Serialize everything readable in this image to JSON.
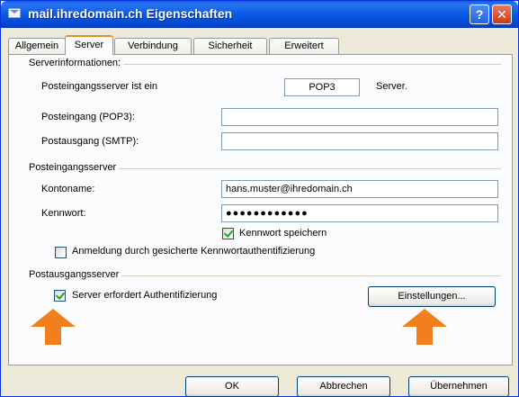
{
  "window": {
    "title": "mail.ihredomain.ch Eigenschaften",
    "help_label": "?",
    "close_label": "✕"
  },
  "tabs": [
    {
      "label": "Allgemein"
    },
    {
      "label": "Server"
    },
    {
      "label": "Verbindung"
    },
    {
      "label": "Sicherheit"
    },
    {
      "label": "Erweitert"
    }
  ],
  "server_info": {
    "group_label": "Serverinformationen:",
    "incoming_type_label": "Posteingangsserver ist ein",
    "incoming_type_value": "POP3",
    "incoming_type_suffix": "Server.",
    "pop3_label": "Posteingang (POP3):",
    "pop3_value": "",
    "smtp_label": "Postausgang (SMTP):",
    "smtp_value": ""
  },
  "incoming_server": {
    "group_label": "Posteingangsserver",
    "account_label": "Kontoname:",
    "account_value": "hans.muster@ihredomain.ch",
    "password_label": "Kennwort:",
    "password_value": "●●●●●●●●●●●●",
    "save_password_label": "Kennwort speichern",
    "save_password_checked": true,
    "spa_label": "Anmeldung durch gesicherte Kennwortauthentifizierung",
    "spa_checked": false
  },
  "outgoing_server": {
    "group_label": "Postausgangsserver",
    "auth_label": "Server erfordert Authentifizierung",
    "auth_checked": true,
    "settings_button": "Einstellungen..."
  },
  "footer": {
    "ok": "OK",
    "cancel": "Abbrechen",
    "apply": "Übernehmen"
  },
  "colors": {
    "arrow": "#f07f1c",
    "titlebar": "#0859e6"
  }
}
